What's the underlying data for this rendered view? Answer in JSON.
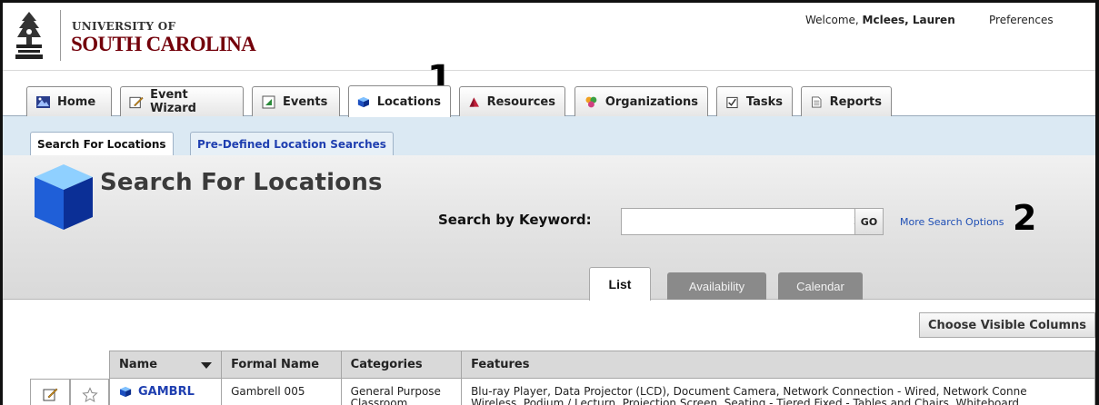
{
  "header": {
    "logo_line1": "UNIVERSITY OF",
    "logo_line2": "SOUTH CAROLINA",
    "welcome_prefix": "Welcome, ",
    "user_name": "Mclees, Lauren",
    "preferences_label": "Preferences"
  },
  "main_tabs": [
    {
      "label": "Home",
      "icon": "home-icon"
    },
    {
      "label": "Event Wizard",
      "icon": "event-wizard-icon"
    },
    {
      "label": "Events",
      "icon": "events-icon"
    },
    {
      "label": "Locations",
      "icon": "locations-cube-icon",
      "active": true
    },
    {
      "label": "Resources",
      "icon": "resources-icon"
    },
    {
      "label": "Organizations",
      "icon": "organizations-icon"
    },
    {
      "label": "Tasks",
      "icon": "tasks-icon"
    },
    {
      "label": "Reports",
      "icon": "reports-icon"
    }
  ],
  "sub_tabs": [
    {
      "label": "Search For Locations",
      "active": true
    },
    {
      "label": "Pre-Defined Location Searches",
      "active": false
    }
  ],
  "search": {
    "title": "Search For Locations",
    "keyword_label": "Search by Keyword:",
    "keyword_value": "",
    "clear_label": "x",
    "go_label": "GO",
    "more_options_label": "More Search Options"
  },
  "view_tabs": [
    {
      "label": "List",
      "active": true
    },
    {
      "label": "Availability",
      "active": false
    },
    {
      "label": "Calendar",
      "active": false
    }
  ],
  "callouts": [
    "1",
    "2"
  ],
  "list": {
    "choose_columns_label": "Choose Visible Columns",
    "columns": [
      "Name",
      "Formal Name",
      "Categories",
      "Features"
    ],
    "rows": [
      {
        "name": "GAMBRL",
        "formal_name": "Gambrell 005",
        "categories_line1": "General Purpose",
        "categories_line2": "Classroom",
        "features_line1": "Blu-ray Player, Data Projector (LCD), Document Camera, Network Connection - Wired, Network Conne",
        "features_line2": "Wireless, Podium / Lecturn, Projection Screen, Seating - Tiered Fixed - Tables and Chairs, Whiteboard"
      }
    ]
  },
  "colors": {
    "brand_garnet": "#73000a",
    "link_blue": "#1f3fb0",
    "subtab_bar": "#dbe9f3"
  }
}
